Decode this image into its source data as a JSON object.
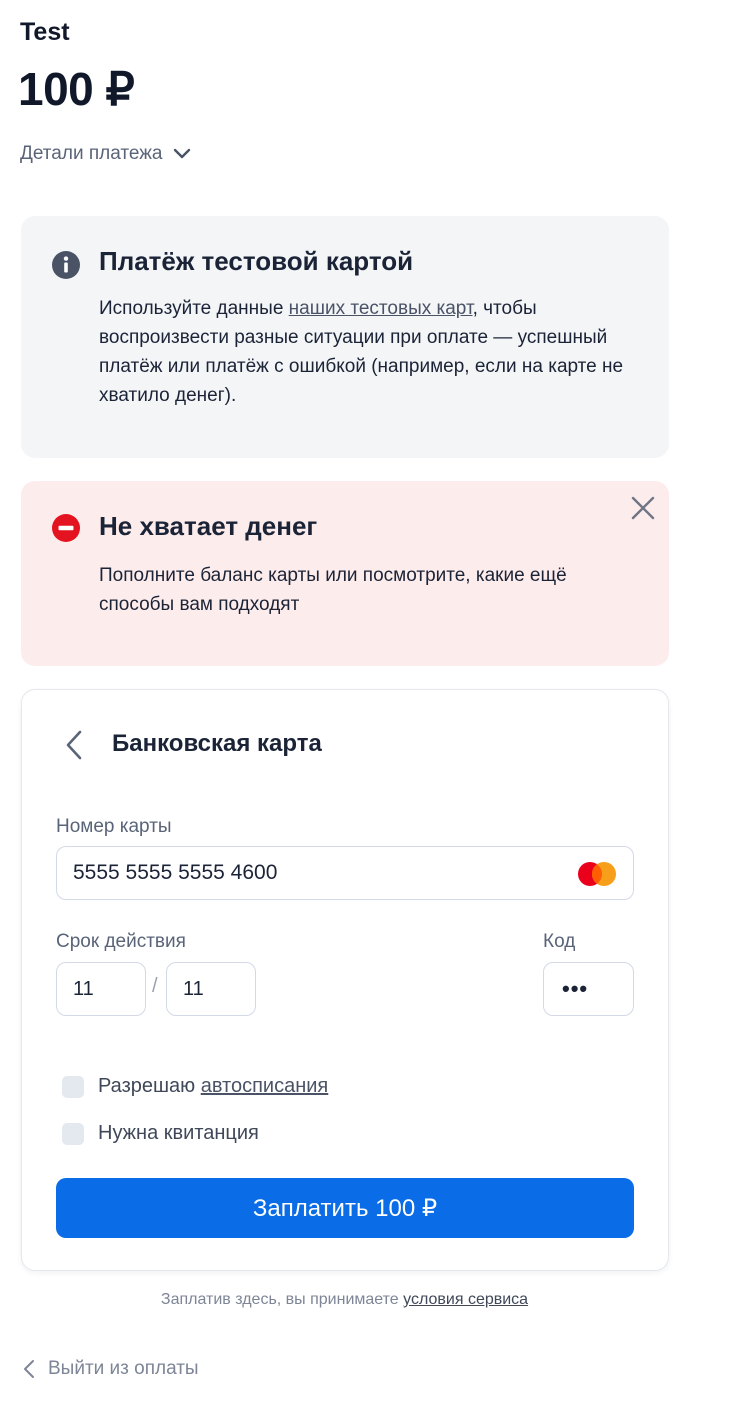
{
  "header": {
    "merchant": "Test",
    "amount": "100 ₽",
    "details_label": "Детали платежа"
  },
  "info_notice": {
    "icon": "info-icon",
    "title": "Платёж тестовой картой",
    "text_before": "Используйте данные ",
    "link_text": "наших тестовых карт",
    "text_after": ", чтобы воспроизвести разные ситуации при оплате — успешный платёж или платёж с ошибкой (например, если на карте не хватило денег)."
  },
  "error_notice": {
    "icon": "error-minus-icon",
    "title": "Не хватает денег",
    "text": "Пополните баланс карты или посмотрите, какие ещё способы вам подходят",
    "close_icon": "close-icon"
  },
  "card_form": {
    "title": "Банковская карта",
    "card_number_label": "Номер карты",
    "card_number_value": "5555 5555 5555 4600",
    "card_brand_icon": "mastercard-icon",
    "expiry_label": "Срок действия",
    "expiry_month": "11",
    "expiry_separator": "/",
    "expiry_year": "11",
    "code_label": "Код",
    "code_value": "•••",
    "autopay_text": "Разрешаю ",
    "autopay_link": "автосписания",
    "receipt_label": "Нужна квитанция",
    "pay_button_label": "Заплатить 100 ₽"
  },
  "footer": {
    "terms_text": "Заплатив здесь, вы принимаете ",
    "terms_link": "условия сервиса",
    "exit_label": "Выйти из оплаты"
  },
  "colors": {
    "accent": "#0a6ce6",
    "error_bg": "#fdecec",
    "error_icon": "#e3131f",
    "info_bg": "#f3f5f7",
    "info_icon": "#4a5366"
  }
}
